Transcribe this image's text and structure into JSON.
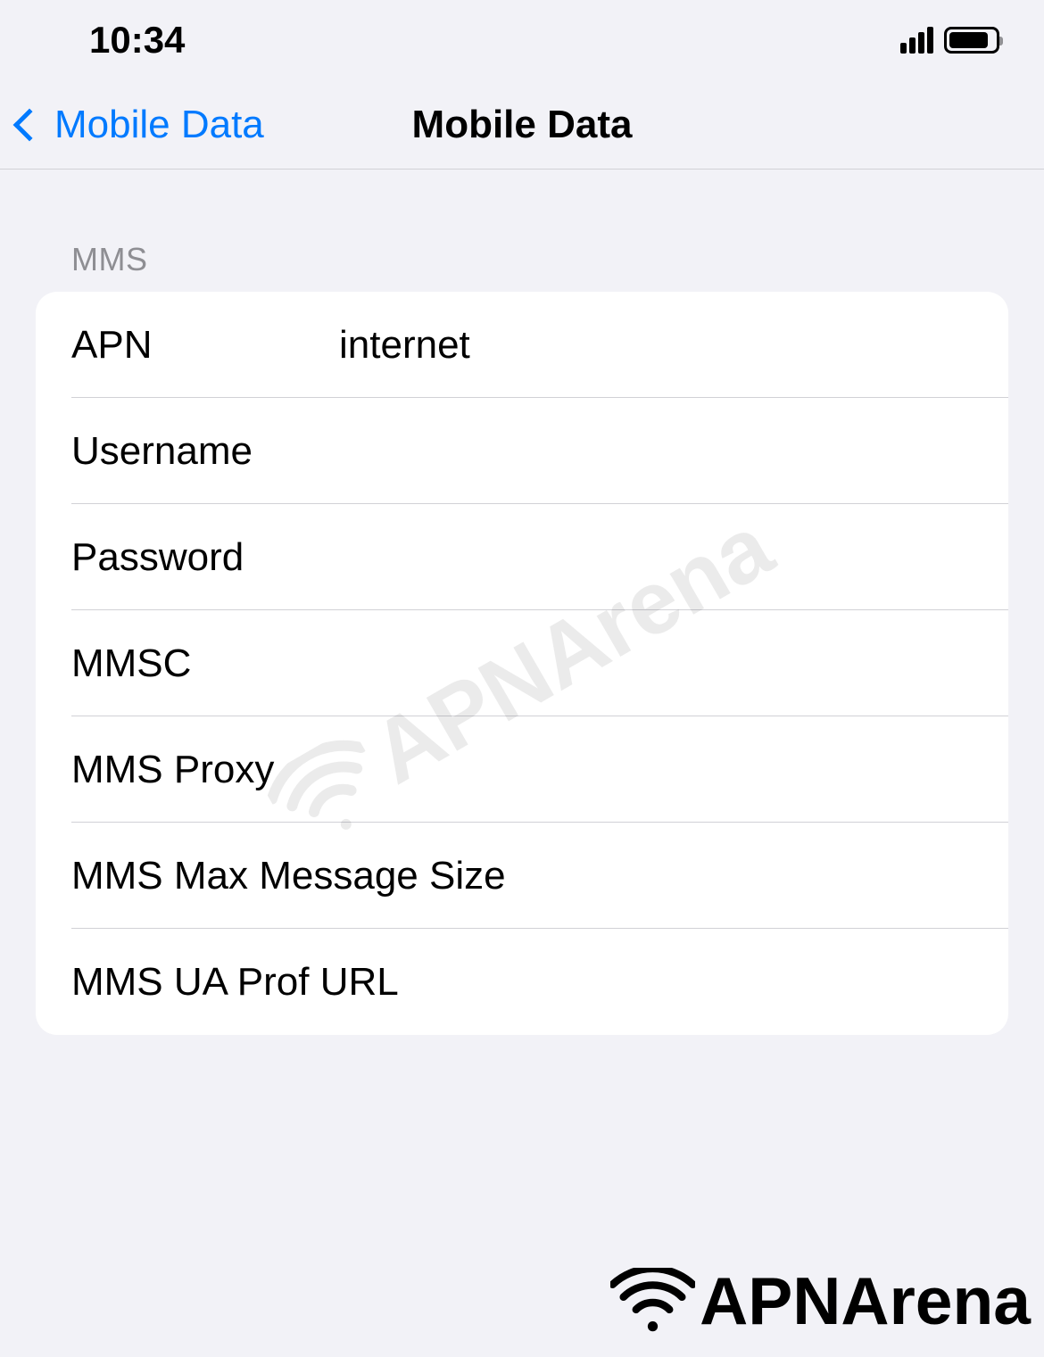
{
  "status": {
    "time": "10:34"
  },
  "nav": {
    "back_label": "Mobile Data",
    "title": "Mobile Data"
  },
  "section": {
    "header": "MMS"
  },
  "fields": {
    "apn": {
      "label": "APN",
      "value": "internet"
    },
    "username": {
      "label": "Username",
      "value": ""
    },
    "password": {
      "label": "Password",
      "value": ""
    },
    "mmsc": {
      "label": "MMSC",
      "value": ""
    },
    "mms_proxy": {
      "label": "MMS Proxy",
      "value": ""
    },
    "mms_max_size": {
      "label": "MMS Max Message Size",
      "value": ""
    },
    "mms_ua_prof": {
      "label": "MMS UA Prof URL",
      "value": ""
    }
  },
  "branding": {
    "watermark_text": "APNArena",
    "logo_text": "APNArena"
  }
}
